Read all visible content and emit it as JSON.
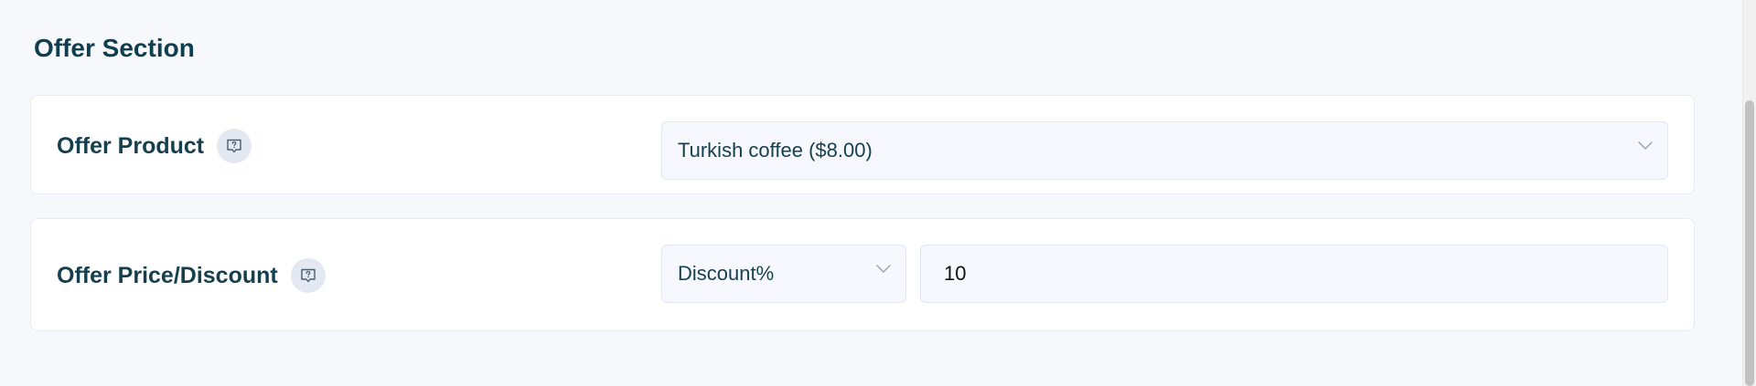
{
  "section": {
    "title": "Offer Section"
  },
  "offer_product": {
    "label": "Offer Product",
    "help_icon": "help-chat-icon",
    "selected": "Turkish coffee ($8.00)"
  },
  "offer_price": {
    "label": "Offer Price/Discount",
    "help_icon": "help-chat-icon",
    "type_selected": "Discount%",
    "amount": "10"
  },
  "colors": {
    "page_bg": "#f7f8fc",
    "card_bg": "#ffffff",
    "text": "#16404f",
    "field_bg": "#f6f8fd",
    "badge_bg": "#e3e8f3"
  }
}
